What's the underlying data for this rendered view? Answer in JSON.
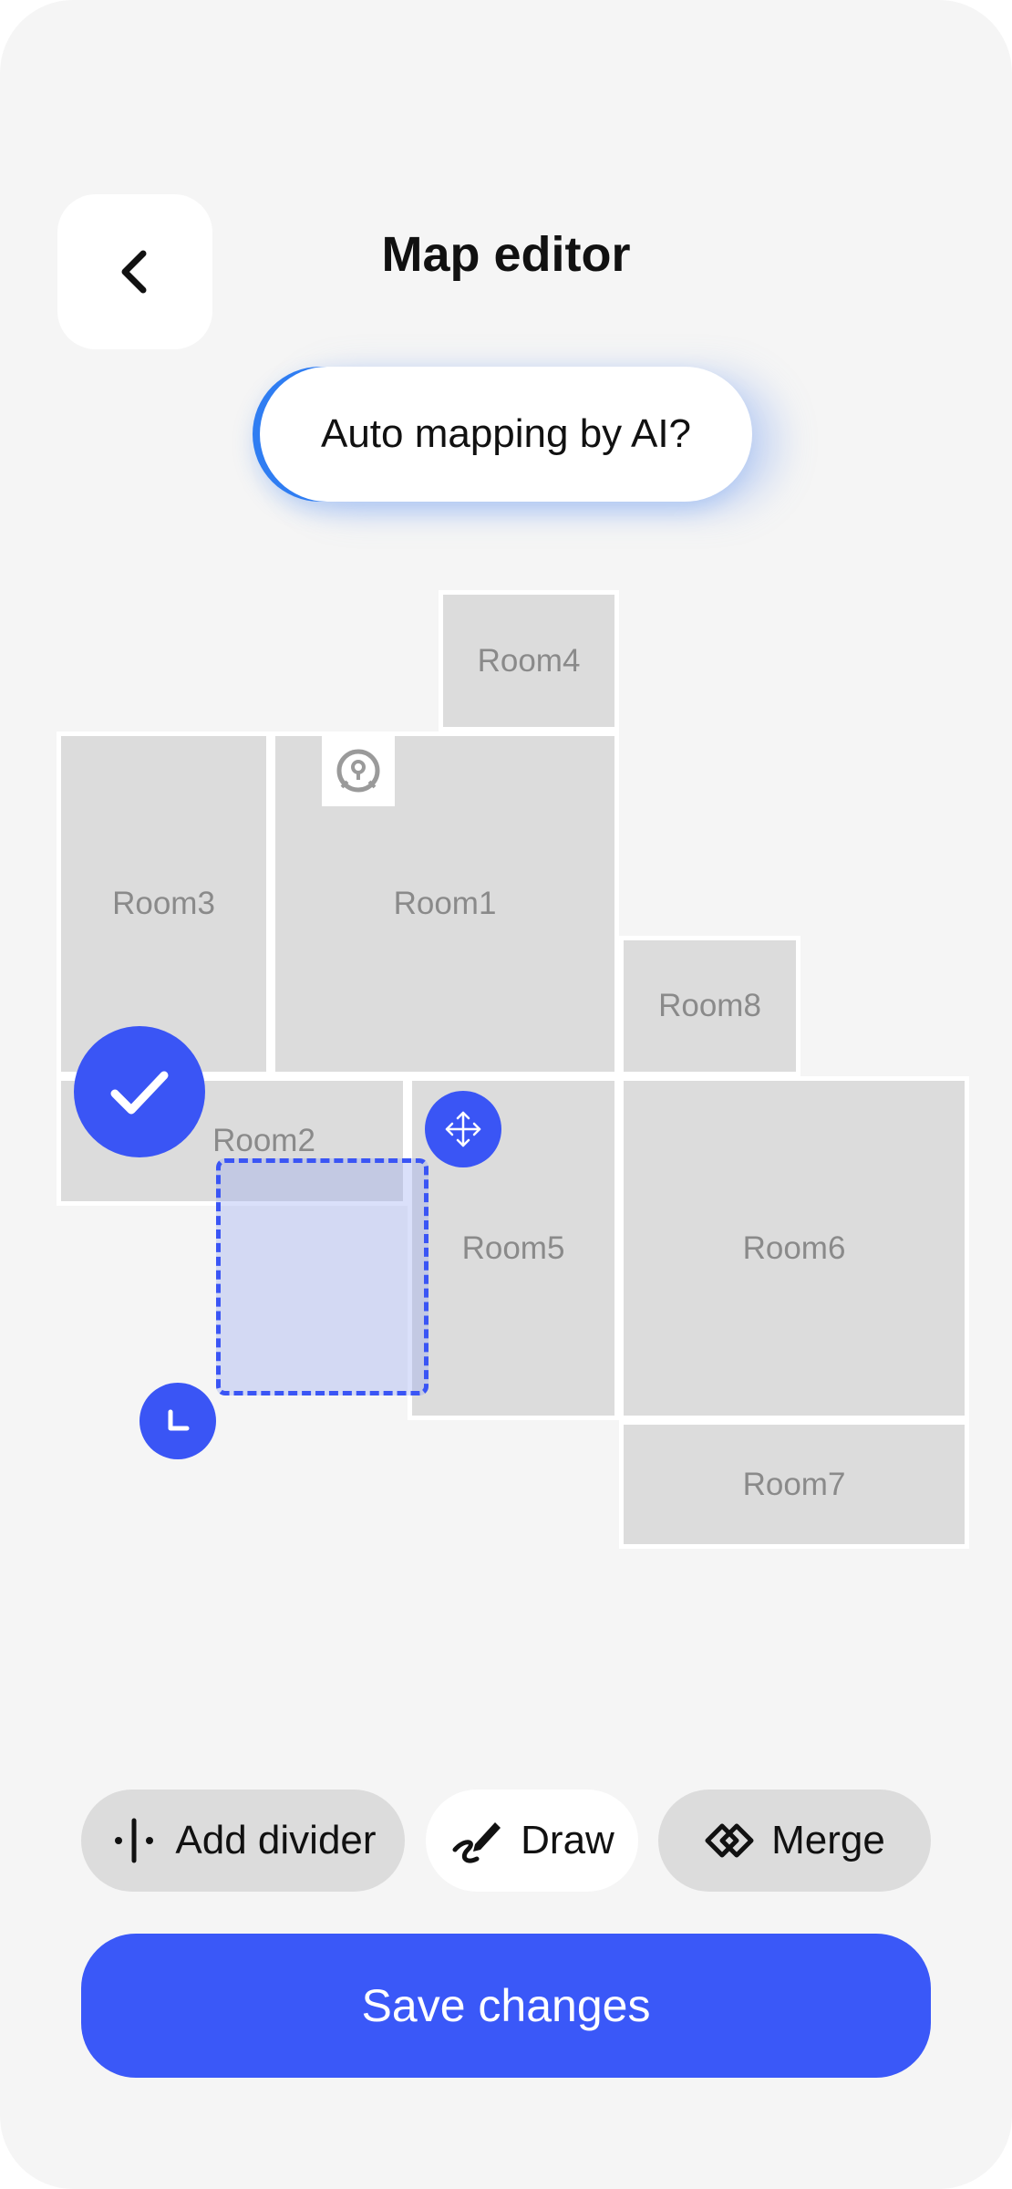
{
  "header": {
    "title": "Map editor"
  },
  "ai_prompt": {
    "label": "Auto mapping by AI?"
  },
  "rooms": {
    "room1": "Room1",
    "room2": "Room2",
    "room3": "Room3",
    "room4": "Room4",
    "room5": "Room5",
    "room6": "Room6",
    "room7": "Room7",
    "room8": "Room8"
  },
  "toolbar": {
    "add_divider": "Add divider",
    "draw": "Draw",
    "merge": "Merge",
    "active_tool": "Draw"
  },
  "footer": {
    "save_label": "Save changes"
  },
  "colors": {
    "accent": "#3a58f8",
    "room_fill": "#dcdcdc",
    "background": "#f5f5f5"
  },
  "icons": {
    "back": "chevron-left-icon",
    "robot": "robot-vacuum-icon",
    "confirm": "check-icon",
    "move": "move-arrows-icon",
    "resize": "resize-corner-icon",
    "divider": "divider-icon",
    "draw": "pen-icon",
    "merge": "merge-icon"
  }
}
